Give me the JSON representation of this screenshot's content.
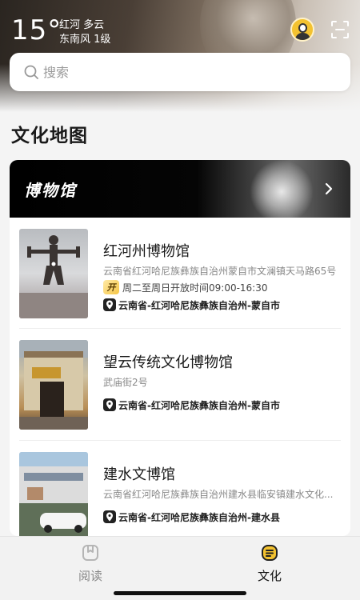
{
  "header": {
    "temperature": "15°",
    "weather_line1": "红河  多云",
    "weather_line2": "东南风 1级"
  },
  "search": {
    "placeholder": "搜索"
  },
  "section": {
    "title": "文化地图"
  },
  "category": {
    "title": "博物馆"
  },
  "museums": [
    {
      "name": "红河州博物馆",
      "address": "云南省红河哈尼族彝族自治州蒙自市文澜镇天马路65号",
      "open_badge": "开",
      "hours": "周二至周日开放时间09:00-16:30",
      "region": "云南省-红河哈尼族彝族自治州-蒙自市"
    },
    {
      "name": "望云传统文化博物馆",
      "address": "武庙街2号",
      "region": "云南省-红河哈尼族彝族自治州-蒙自市"
    },
    {
      "name": "建水文博馆",
      "address": "云南省红河哈尼族彝族自治州建水县临安镇建水文化...",
      "region": "云南省-红河哈尼族彝族自治州-建水县"
    }
  ],
  "nav": {
    "items": [
      {
        "label": "阅读",
        "icon": "book-icon",
        "active": false
      },
      {
        "label": "文化",
        "icon": "culture-icon",
        "active": true
      }
    ]
  },
  "colors": {
    "accent_yellow": "#f3c230",
    "text_dark": "#1a1a1a",
    "text_gray": "#888888"
  }
}
